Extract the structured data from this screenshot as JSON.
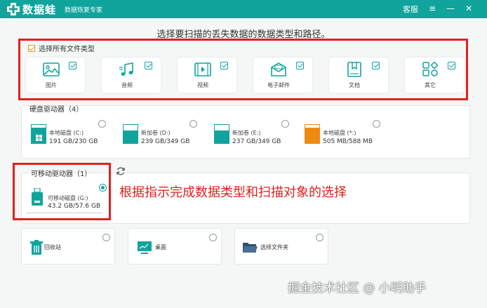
{
  "app": {
    "brand": "数据蛙",
    "subtitle": "数据恢复专家",
    "service": "客服",
    "controls": {
      "menu": "≡",
      "minimize": "—",
      "close": "✕"
    }
  },
  "headline": "选择要扫描的丢失数据的数据类型和路径。",
  "file_types": {
    "select_all_label": "选择所有文件类型",
    "select_all_checked": true,
    "items": [
      {
        "label": "图片",
        "icon": "image-icon",
        "checked": true
      },
      {
        "label": "音频",
        "icon": "audio-icon",
        "checked": true
      },
      {
        "label": "视频",
        "icon": "video-icon",
        "checked": true
      },
      {
        "label": "电子邮件",
        "icon": "email-icon",
        "checked": true
      },
      {
        "label": "文档",
        "icon": "document-icon",
        "checked": true
      },
      {
        "label": "其它",
        "icon": "other-icon",
        "checked": true
      }
    ]
  },
  "hard_drives": {
    "title": "硬盘驱动器（4）",
    "items": [
      {
        "name": "本地磁盘 (C:)",
        "size": "191 GB/230 GB",
        "fill": 0.83,
        "color": "#10a49c",
        "has_os": true,
        "selected": false
      },
      {
        "name": "新加卷 (D:)",
        "size": "239 GB/349 GB",
        "fill": 0.68,
        "color": "#10a49c",
        "has_os": false,
        "selected": false
      },
      {
        "name": "新加卷 (E:)",
        "size": "237 GB/349 GB",
        "fill": 0.68,
        "color": "#10a49c",
        "has_os": false,
        "selected": false
      },
      {
        "name": "本地磁盘 (*:)",
        "size": "505 MB/588 MB",
        "fill": 0.86,
        "color": "#ef8a10",
        "has_os": false,
        "selected": false
      }
    ]
  },
  "removable": {
    "title": "可移动驱动器（1）",
    "items": [
      {
        "name": "可移动磁盘 (G:)",
        "size": "43.2 GB/57.6 GB",
        "fill": 0.75,
        "selected": true
      }
    ]
  },
  "annotation": "根据指示完成数据类型和扫描对象的选择",
  "quick_locations": [
    {
      "label": "回收站",
      "icon": "recycle-bin-icon",
      "selected": false
    },
    {
      "label": "桌面",
      "icon": "desktop-icon",
      "selected": false
    },
    {
      "label": "选择文件夹",
      "icon": "folder-icon",
      "selected": false
    }
  ],
  "watermark": "掘金技术社区 @ 小明助手",
  "colors": {
    "accent": "#10a49c",
    "highlight": "#e02020",
    "drive_alt": "#ef8a10",
    "checkbox": "#d99a2b"
  }
}
